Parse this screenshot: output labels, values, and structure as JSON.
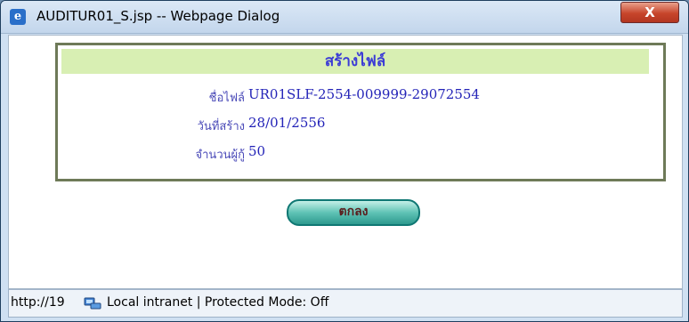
{
  "window": {
    "title": "AUDITUR01_S.jsp -- Webpage Dialog",
    "close_label": "X"
  },
  "panel": {
    "header": "สร้างไฟล์",
    "rows": [
      {
        "label": "ชื่อไฟล์",
        "value": "UR01SLF-2554-009999-29072554"
      },
      {
        "label": "วันที่สร้าง",
        "value": "28/01/2556"
      },
      {
        "label": "จำนวนผู้กู้",
        "value": "50"
      }
    ]
  },
  "ok_button": "ตกลง",
  "status": {
    "url": "http://19",
    "zone": "Local intranet | Protected Mode: Off"
  },
  "icons": {
    "title": "ie-icon",
    "status": "intranet-icon"
  }
}
